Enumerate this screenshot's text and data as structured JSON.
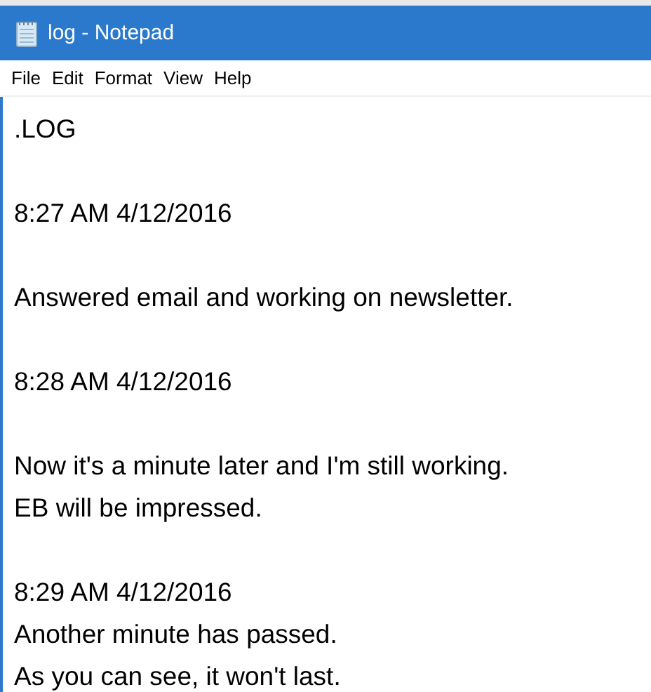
{
  "window": {
    "title": "log - Notepad"
  },
  "menu": [
    "File",
    "Edit",
    "Format",
    "View",
    "Help"
  ],
  "document": {
    "paragraphs": [
      [
        ".LOG"
      ],
      [
        "8:27 AM 4/12/2016"
      ],
      [
        "Answered email and working on newsletter."
      ],
      [
        "8:28 AM 4/12/2016"
      ],
      [
        "Now it's a minute later and I'm still working.",
        "EB will be impressed."
      ],
      [
        "8:29 AM 4/12/2016",
        "Another minute has passed.",
        "As you can see, it won't last."
      ]
    ]
  }
}
